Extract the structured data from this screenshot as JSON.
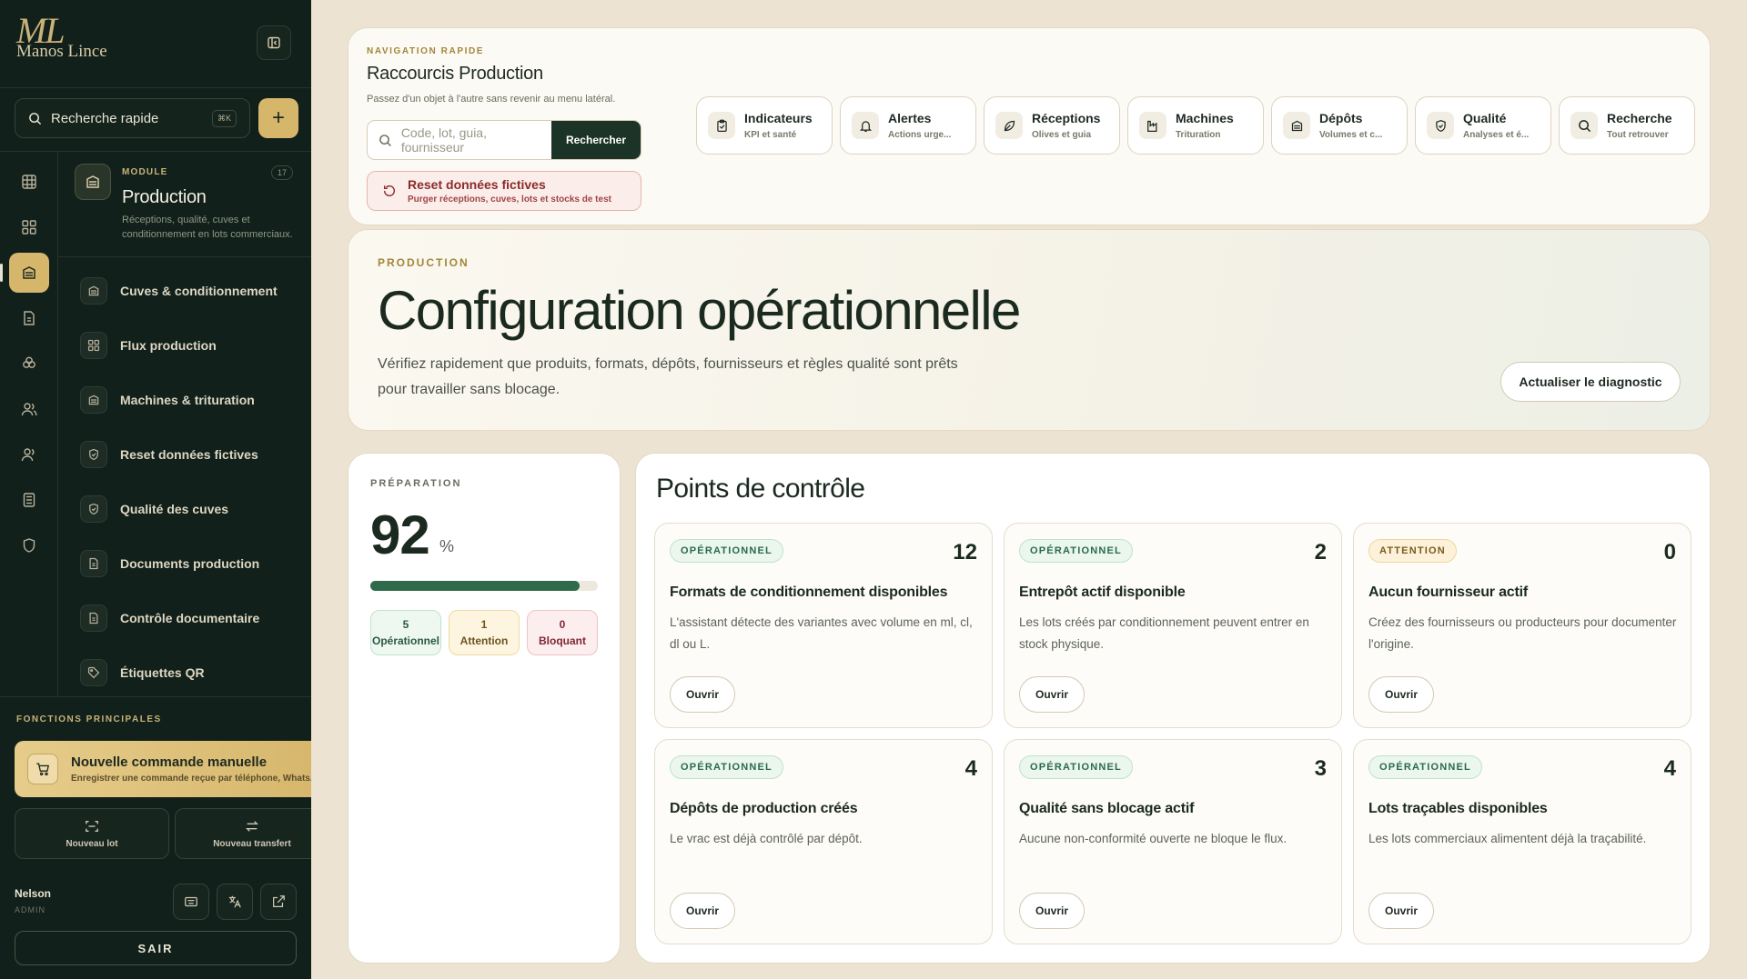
{
  "app": {
    "logo_mark": "ML",
    "logo_name": "Manos Lince"
  },
  "search": {
    "label": "Recherche rapide",
    "shortcut": "⌘K"
  },
  "module": {
    "label": "MODULE",
    "title": "Production",
    "description": "Réceptions, qualité, cuves et conditionnement en lots commerciaux.",
    "count": "17"
  },
  "nav": [
    {
      "label": "Cuves & conditionnement",
      "icon": "vat-icon"
    },
    {
      "label": "Flux production",
      "icon": "grid-icon"
    },
    {
      "label": "Machines & trituration",
      "icon": "vat-icon"
    },
    {
      "label": "Reset données fictives",
      "icon": "shield-icon"
    },
    {
      "label": "Qualité des cuves",
      "icon": "shield-icon"
    },
    {
      "label": "Documents production",
      "icon": "document-icon"
    },
    {
      "label": "Contrôle documentaire",
      "icon": "document-icon"
    },
    {
      "label": "Étiquettes QR",
      "icon": "tag-icon"
    }
  ],
  "functions": {
    "label": "FONCTIONS PRINCIPALES",
    "manual_order": {
      "title": "Nouvelle commande manuelle",
      "subtitle": "Enregistrer une commande reçue par téléphone, WhatsApp"
    },
    "new_lot": "Nouveau lot",
    "new_transfer": "Nouveau transfert"
  },
  "user": {
    "name": "Nelson",
    "role": "ADMIN",
    "logout": "SAIR"
  },
  "quicknav": {
    "eyebrow": "NAVIGATION RAPIDE",
    "title": "Raccourcis Production",
    "subtitle": "Passez d'un objet à l'autre sans revenir au menu latéral.",
    "search_placeholder": "Code, lot, guia, fournisseur",
    "search_button": "Rechercher",
    "reset_title": "Reset données fictives",
    "reset_subtitle": "Purger réceptions, cuves, lots et stocks de test",
    "shortcuts": [
      {
        "title": "Indicateurs",
        "subtitle": "KPI et santé",
        "icon": "clipboard-icon"
      },
      {
        "title": "Alertes",
        "subtitle": "Actions urge...",
        "icon": "bell-icon"
      },
      {
        "title": "Réceptions",
        "subtitle": "Olives et guia",
        "icon": "leaf-icon"
      },
      {
        "title": "Machines",
        "subtitle": "Trituration",
        "icon": "factory-icon"
      },
      {
        "title": "Dépôts",
        "subtitle": "Volumes et c...",
        "icon": "vat-icon"
      },
      {
        "title": "Qualité",
        "subtitle": "Analyses et é...",
        "icon": "shield-icon"
      },
      {
        "title": "Recherche",
        "subtitle": "Tout retrouver",
        "icon": "search-icon"
      }
    ]
  },
  "hero": {
    "eyebrow": "PRODUCTION",
    "title": "Configuration opérationnelle",
    "description": "Vérifiez rapidement que produits, formats, dépôts, fournisseurs et règles qualité sont prêts pour travailler sans blocage.",
    "button": "Actualiser le diagnostic"
  },
  "preparation": {
    "eyebrow": "PRÉPARATION",
    "value": "92",
    "unit": "%",
    "progress": 0.92,
    "operational": {
      "count": "5",
      "label": "Opérationnel"
    },
    "attention": {
      "count": "1",
      "label": "Attention"
    },
    "blocking": {
      "count": "0",
      "label": "Bloquant"
    }
  },
  "checkpoints": {
    "title": "Points de contrôle",
    "open_label": "Ouvrir",
    "items": [
      {
        "status": "OPÉRATIONNEL",
        "kind": "ok",
        "count": "12",
        "title": "Formats de conditionnement disponibles",
        "description": "L'assistant détecte des variantes avec volume en ml, cl, dl ou L."
      },
      {
        "status": "OPÉRATIONNEL",
        "kind": "ok",
        "count": "2",
        "title": "Entrepôt actif disponible",
        "description": "Les lots créés par conditionnement peuvent entrer en stock physique."
      },
      {
        "status": "ATTENTION",
        "kind": "at",
        "count": "0",
        "title": "Aucun fournisseur actif",
        "description": "Créez des fournisseurs ou producteurs pour documenter l'origine."
      },
      {
        "status": "OPÉRATIONNEL",
        "kind": "ok",
        "count": "4",
        "title": "Dépôts de production créés",
        "description": "Le vrac est déjà contrôlé par dépôt."
      },
      {
        "status": "OPÉRATIONNEL",
        "kind": "ok",
        "count": "3",
        "title": "Qualité sans blocage actif",
        "description": "Aucune non-conformité ouverte ne bloque le flux."
      },
      {
        "status": "OPÉRATIONNEL",
        "kind": "ok",
        "count": "4",
        "title": "Lots traçables disponibles",
        "description": "Les lots commerciaux alimentent déjà la traçabilité."
      }
    ]
  },
  "colors": {
    "sidebar": "#11201a",
    "accent": "#d6b66b",
    "primary": "#1c3327",
    "ok": "#2f6a4b",
    "danger": "#8a2b2b"
  }
}
